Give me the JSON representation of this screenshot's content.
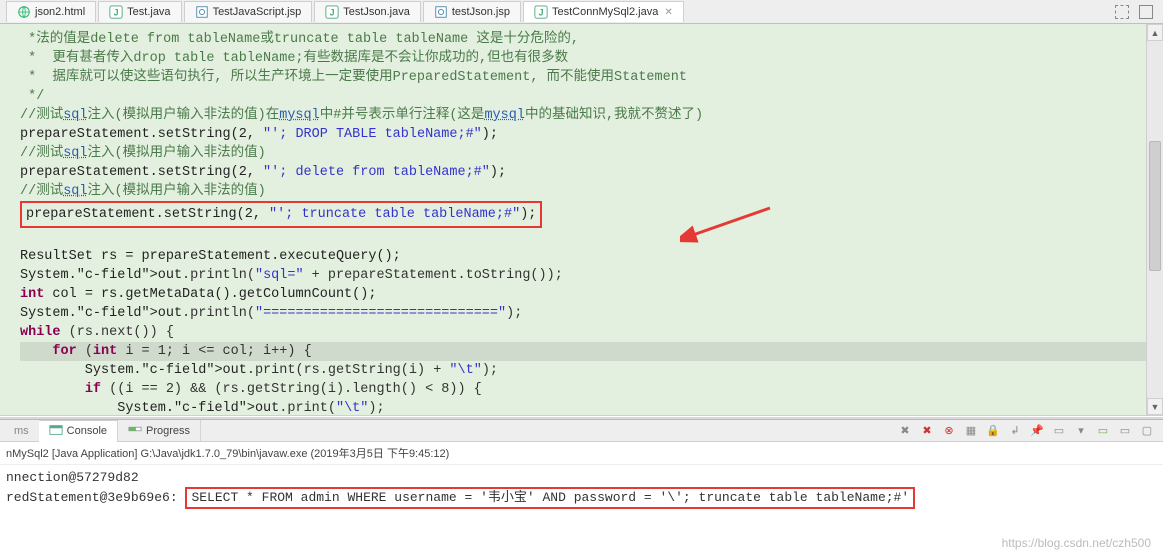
{
  "tabs": [
    {
      "label": "json2.html",
      "icon": "html"
    },
    {
      "label": "Test.java",
      "icon": "java"
    },
    {
      "label": "TestJavaScript.jsp",
      "icon": "jsp"
    },
    {
      "label": "TestJson.java",
      "icon": "java"
    },
    {
      "label": "testJson.jsp",
      "icon": "jsp"
    },
    {
      "label": "TestConnMySql2.java",
      "icon": "java"
    }
  ],
  "active_tab": 5,
  "code_lines": [
    {
      "t": "comment",
      "text": " *法的值是delete from tableName或truncate table tableName 这是十分危险的,"
    },
    {
      "t": "comment",
      "text": " *  更有甚者传入drop table tableName;有些数据库是不会让你成功的,但也有很多数"
    },
    {
      "t": "comment",
      "text": " *  据库就可以使这些语句执行, 所以生产环境上一定要使用PreparedStatement, 而不能使用Statement"
    },
    {
      "t": "comment",
      "text": " */"
    },
    {
      "t": "sqlcomment",
      "text": "//测试sql注入(模拟用户输入非法的值)在mysql中#并号表示单行注释(这是mysql中的基础知识,我就不赘述了)"
    },
    {
      "t": "stmt",
      "parts": [
        "prepareStatement",
        ".",
        "setString",
        "(",
        "2",
        ", ",
        "\"'; DROP TABLE tableName;#\"",
        ")",
        ";"
      ]
    },
    {
      "t": "sqlcomment",
      "text": "//测试sql注入(模拟用户输入非法的值)"
    },
    {
      "t": "stmt",
      "parts": [
        "prepareStatement",
        ".",
        "setString",
        "(",
        "2",
        ", ",
        "\"'; delete from tableName;#\"",
        ")",
        ";"
      ]
    },
    {
      "t": "sqlcomment",
      "text": "//测试sql注入(模拟用户输入非法的值)"
    },
    {
      "t": "redbox",
      "parts": [
        "prepareStatement",
        ".",
        "setString",
        "(",
        "2",
        ", ",
        "\"'; truncate table tableName;#\"",
        ")",
        ";"
      ]
    },
    {
      "t": "blank",
      "text": ""
    },
    {
      "t": "stmt2",
      "text": "ResultSet rs = prepareStatement.executeQuery();"
    },
    {
      "t": "sysout",
      "text": "System.out.println(\"sql=\" + prepareStatement.toString());"
    },
    {
      "t": "stmt2kw",
      "pre": "int",
      "text": " col = rs.getMetaData().getColumnCount();"
    },
    {
      "t": "sysout",
      "text": "System.out.println(\"=============================\");"
    },
    {
      "t": "while",
      "text": "while (rs.next()) {"
    },
    {
      "t": "for",
      "text": "    for (int i = 1; i <= col; i++) {",
      "hl": true
    },
    {
      "t": "sysout",
      "text": "        System.out.print(rs.getString(i) + \"\\t\");"
    },
    {
      "t": "if",
      "text": "        if ((i == 2) && (rs.getString(i).length() < 8)) {"
    },
    {
      "t": "sysout",
      "text": "            System.out.print(\"\\t\");"
    }
  ],
  "bottom_tabs": {
    "left_trunc": "ms",
    "items": [
      "Console",
      "Progress"
    ],
    "active": 0
  },
  "console": {
    "header": "nMySql2 [Java Application] G:\\Java\\jdk1.7.0_79\\bin\\javaw.exe (2019年3月5日 下午9:45:12)",
    "lines": [
      "nnection@57279d82",
      "redStatement@3e9b69e6: "
    ],
    "sql_box": "SELECT * FROM admin WHERE username = '韦小宝' AND password = '\\'; truncate table tableName;#'"
  },
  "toolbar_icons": [
    "x-gray",
    "x-red",
    "x-all",
    "lock",
    "scroll",
    "pipe",
    "console-select",
    "toggle",
    "rect",
    "min",
    "max"
  ],
  "watermark": "https://blog.csdn.net/czh500"
}
